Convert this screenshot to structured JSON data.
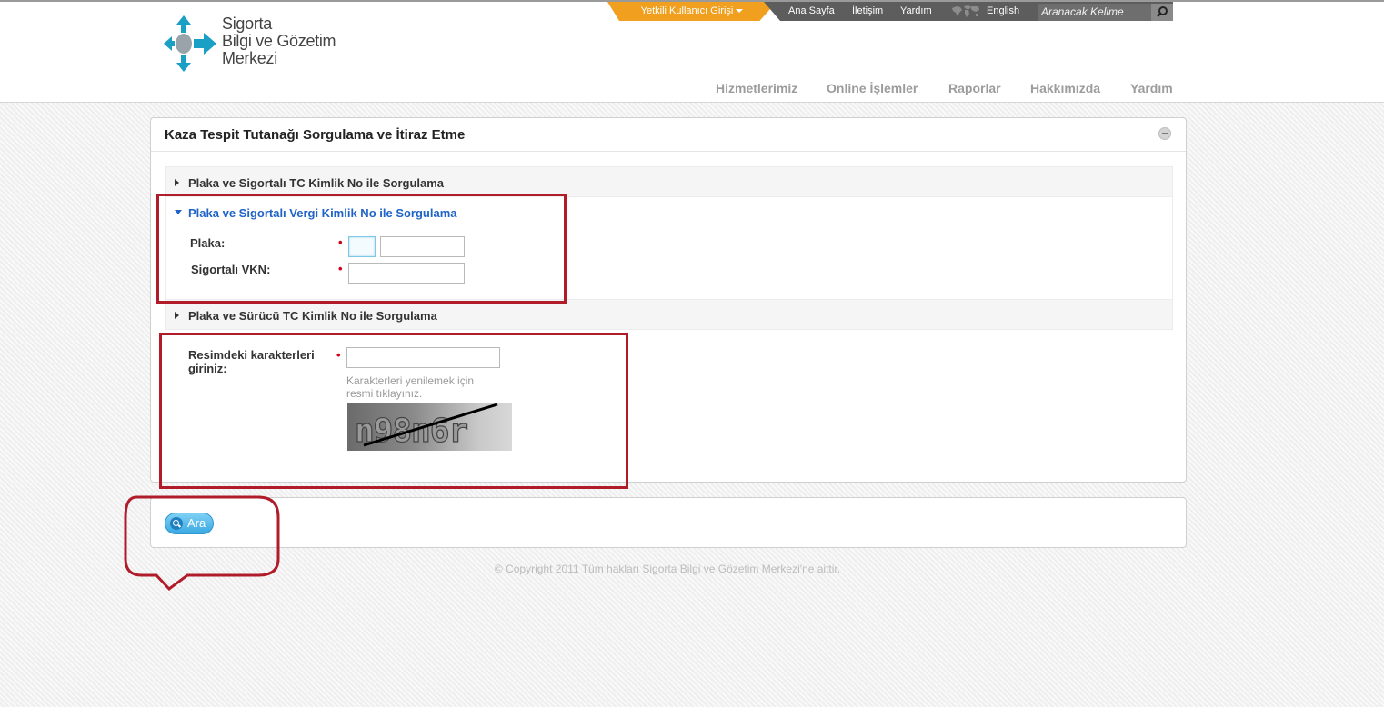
{
  "logo": {
    "line1": "Sigorta",
    "line2": "Bilgi ve Gözetim",
    "line3": "Merkezi"
  },
  "topbar": {
    "login": "Yetkili Kullanıcı Girişi",
    "links": [
      "Ana Sayfa",
      "İletişim",
      "Yardım"
    ],
    "language": "English",
    "search_placeholder": "Aranacak Kelime"
  },
  "nav": [
    "Hizmetlerimiz",
    "Online İşlemler",
    "Raporlar",
    "Hakkımızda",
    "Yardım"
  ],
  "panel": {
    "title": "Kaza Tespit Tutanağı Sorgulama ve İtiraz Etme",
    "sections": [
      "Plaka ve Sigortalı TC Kimlik No ile Sorgulama",
      "Plaka ve Sigortalı Vergi Kimlik No ile Sorgulama",
      "Plaka ve Sürücü TC Kimlik No ile Sorgulama"
    ],
    "plaka_label": "Plaka:",
    "vkn_label": "Sigortalı VKN:",
    "captcha_label_1": "Resimdeki karakterleri",
    "captcha_label_2": "giriniz:",
    "captcha_hint_1": "Karakterleri yenilemek için",
    "captcha_hint_2": "resmi tıklayınız.",
    "captcha_text": "n98n6r",
    "required_mark": "•"
  },
  "search_button": "Ara",
  "footer": "© Copyright 2011 Tüm hakları Sigorta Bilgi ve Gözetim Merkezi'ne aittir.",
  "colors": {
    "accent_orange": "#f0a01e",
    "link_blue": "#1f63c7",
    "annotation_red": "#b01c2a",
    "button_blue": "#3aa9e2"
  }
}
